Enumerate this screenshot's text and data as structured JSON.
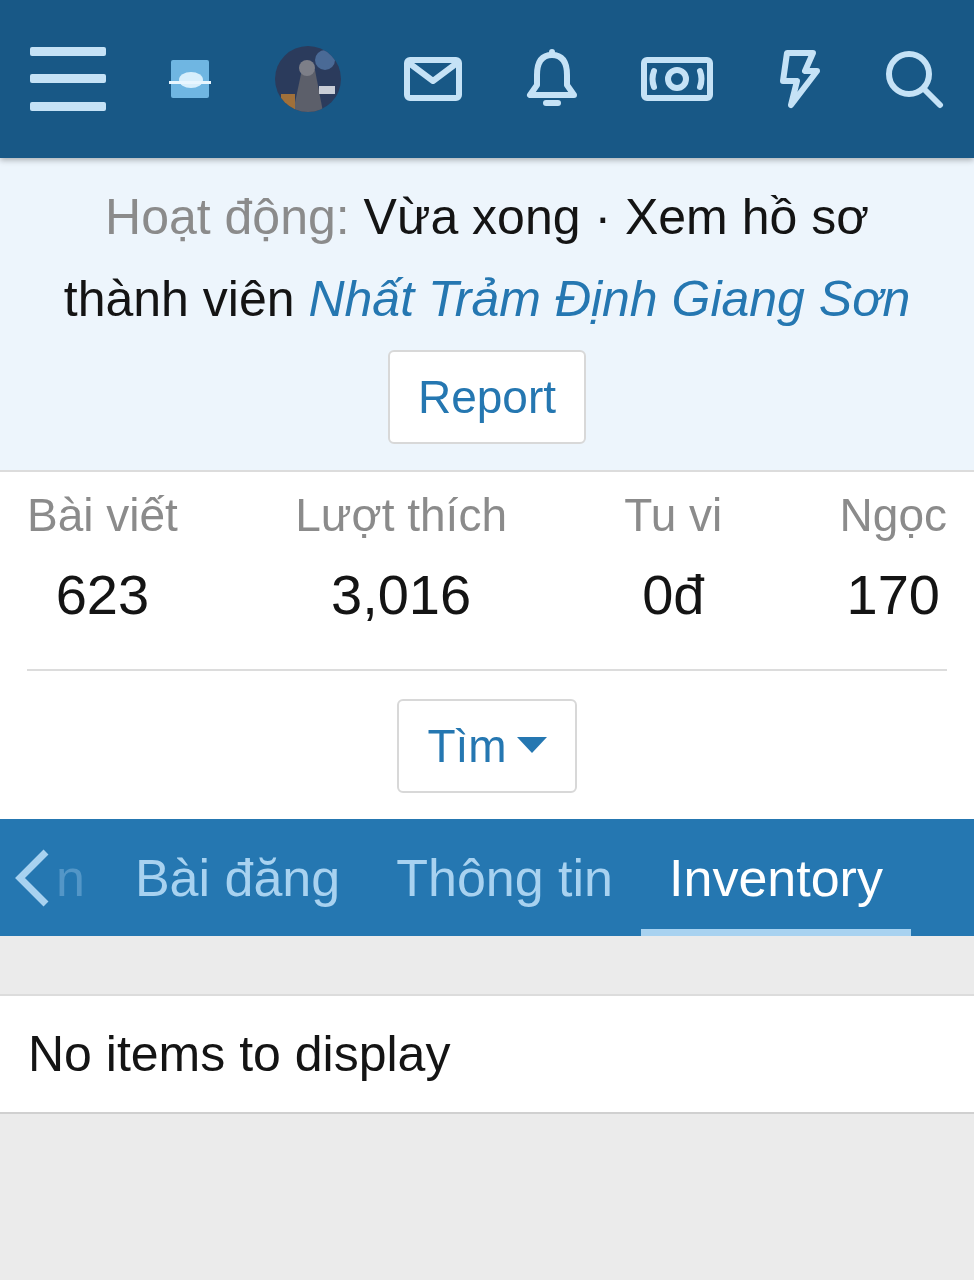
{
  "profile": {
    "activity_label": "Hoạt động:",
    "activity_value": "Vừa xong · Xem hồ sơ thành viên",
    "member_name": "Nhất Trảm Định Giang Sơn",
    "report_button": "Report"
  },
  "stats": [
    {
      "label": "Bài viết",
      "value": "623"
    },
    {
      "label": "Lượt thích",
      "value": "3,016"
    },
    {
      "label": "Tu vi",
      "value": "0đ"
    },
    {
      "label": "Ngọc",
      "value": "170"
    }
  ],
  "find_button": "Tìm",
  "tabs": [
    {
      "label": "n",
      "selected": false,
      "faded": true
    },
    {
      "label": "Bài đăng",
      "selected": false,
      "faded": false
    },
    {
      "label": "Thông tin",
      "selected": false,
      "faded": false
    },
    {
      "label": "Inventory",
      "selected": true,
      "faded": false
    }
  ],
  "content": {
    "empty_message": "No items to display"
  }
}
